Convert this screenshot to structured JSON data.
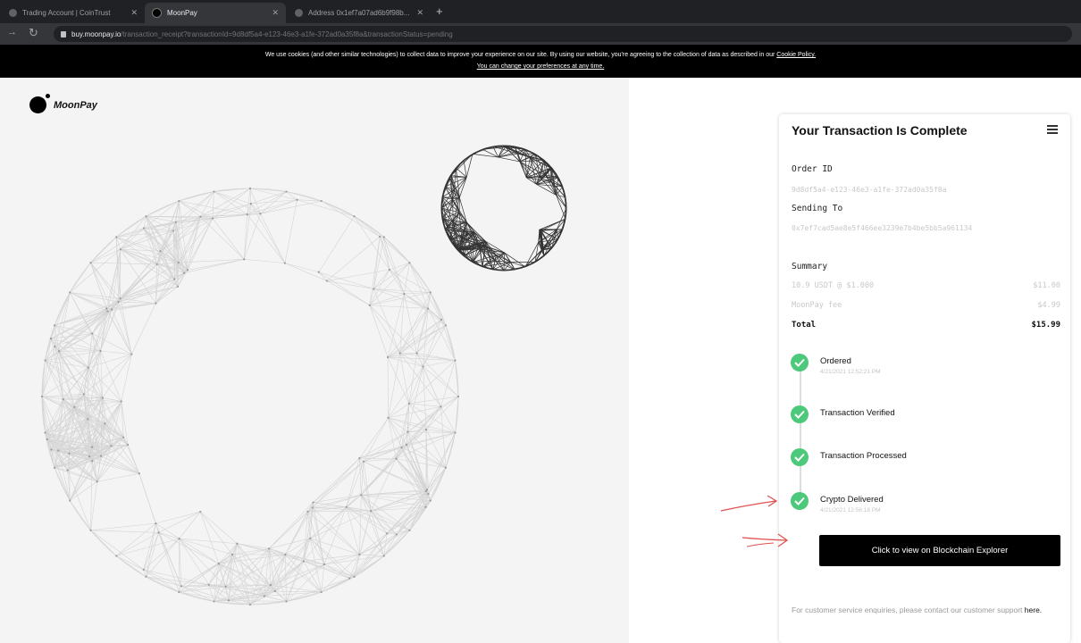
{
  "browser": {
    "tabs": [
      {
        "title": "Trading Account | CoinTrust",
        "active": false
      },
      {
        "title": "MoonPay",
        "active": true
      },
      {
        "title": "Address 0x1ef7a07ad6b9f98b...",
        "active": false
      }
    ],
    "url_host": "buy.moonpay.io",
    "url_path": "/transaction_receipt?transactionId=9d8df5a4-e123-46e3-a1fe-372ad0a35f8a&transactionStatus=pending"
  },
  "cookie_banner": {
    "text": "We use cookies (and other similar technologies) to collect data to improve your experience on our site. By using our website, you're agreeing to the collection of data as described in our",
    "policy_link": "Cookie Policy.",
    "preferences_link": "You can change your preferences at any time."
  },
  "brand": {
    "name": "MoonPay",
    "icon": "moonpay-logo-icon"
  },
  "transaction": {
    "title": "Your Transaction Is Complete",
    "order_id_label": "Order ID",
    "order_id": "9d8df5a4-e123-46e3-a1fe-372ad0a35f8a",
    "sending_to_label": "Sending To",
    "sending_to": "0x7ef7cad5ae8e5f466ee3239e7b4be5bb5a961134",
    "summary_label": "Summary",
    "summary_rows": [
      {
        "label": "10.9 USDT @ $1.000",
        "value": "$11.00"
      },
      {
        "label": "MoonPay fee",
        "value": "$4.99"
      }
    ],
    "total_label": "Total",
    "total_value": "$15.99",
    "steps": [
      {
        "label": "Ordered",
        "time": "4/21/2021 12:52:21 PM"
      },
      {
        "label": "Transaction Verified",
        "time": ""
      },
      {
        "label": "Transaction Processed",
        "time": ""
      },
      {
        "label": "Crypto Delivered",
        "time": "4/21/2021 12:56:18 PM"
      }
    ],
    "explorer_button": "Click to view on Blockchain Explorer",
    "support_text": "For customer service enquiries, please contact our customer support",
    "support_link": "here."
  },
  "colors": {
    "check_green": "#4cc97b",
    "annotation_red": "#e0524f",
    "button_black": "#000000"
  }
}
